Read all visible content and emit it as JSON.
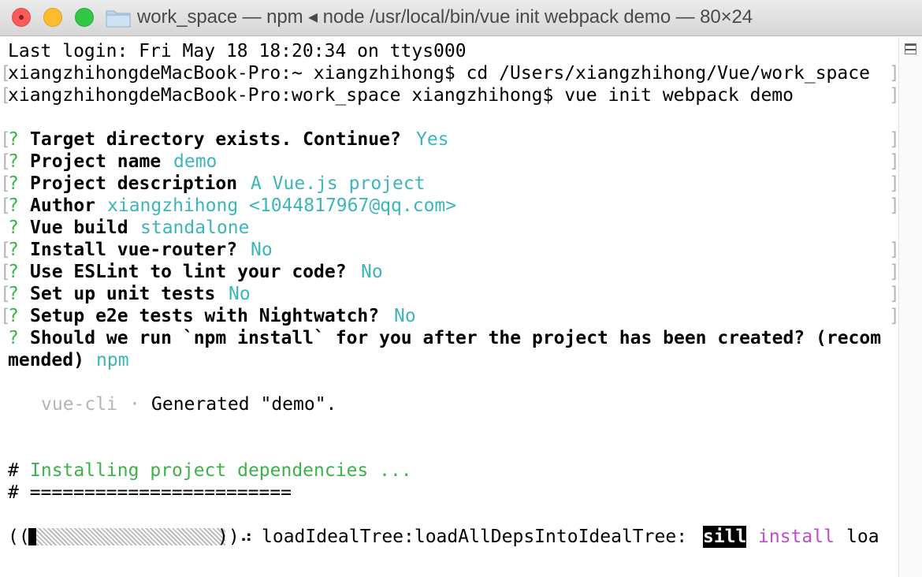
{
  "window": {
    "title": "work_space — npm ◂ node /usr/local/bin/vue init webpack demo — 80×24"
  },
  "terminal": {
    "last_login": "Last login: Fri May 18 18:20:34 on ttys000",
    "cmd1": "xiangzhihongdeMacBook-Pro:~ xiangzhihong$ cd /Users/xiangzhihong/Vue/work_space",
    "cmd2": "xiangzhihongdeMacBook-Pro:work_space xiangzhihong$ vue init webpack demo",
    "prompts": [
      {
        "mark": "?",
        "question": "Target directory exists. Continue?",
        "answer": "Yes"
      },
      {
        "mark": "?",
        "question": "Project name",
        "answer": "demo"
      },
      {
        "mark": "?",
        "question": "Project description",
        "answer": "A Vue.js project"
      },
      {
        "mark": "?",
        "question": "Author",
        "answer": "xiangzhihong <1044817967@qq.com>"
      },
      {
        "mark": "?",
        "question": "Vue build",
        "answer": "standalone"
      },
      {
        "mark": "?",
        "question": "Install vue-router?",
        "answer": "No"
      },
      {
        "mark": "?",
        "question": "Use ESLint to lint your code?",
        "answer": "No"
      },
      {
        "mark": "?",
        "question": "Set up unit tests",
        "answer": "No"
      },
      {
        "mark": "?",
        "question": "Setup e2e tests with Nightwatch?",
        "answer": "No"
      },
      {
        "mark": "?",
        "question": "Should we run `npm install` for you after the project has been created? (recom",
        "answer": ""
      }
    ],
    "wrap_line_text": "mended)",
    "wrap_line_answer": "npm",
    "generated_prefix": "vue-cli",
    "generated_sep": "·",
    "generated_text": "Generated \"demo\".",
    "installing_hash": "#",
    "installing_text": "Installing project dependencies ...",
    "separator": "# ========================",
    "progress": {
      "open": "((",
      "close": "))",
      "fraction": 0.04,
      "spinner": "⠴",
      "status": "loadIdealTree:loadAllDepsIntoIdealTree:",
      "badge": "sill",
      "keyword": "install",
      "tail": "loa"
    },
    "bracket_left": "[",
    "bracket_right": "]"
  },
  "colors": {
    "prompt_mark": "#3db24a",
    "answer": "#3cb5bb",
    "install_heading": "#3db24a",
    "keyword": "#c04cc9",
    "dim": "#b5b5b5"
  }
}
